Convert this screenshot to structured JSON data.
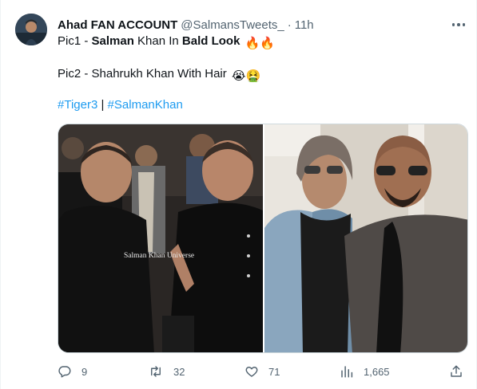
{
  "tweet": {
    "author_name": "Ahad FAN ACCOUNT",
    "handle": "@SalmansTweets_",
    "separator": "·",
    "time": "11h",
    "line1": {
      "prefix": "Pic1 - ",
      "bold1": "Salman",
      "mid": " Khan In ",
      "bold2": "Bald Look",
      "emoji": "🔥🔥"
    },
    "line2": {
      "text": "Pic2 - Shahrukh Khan With Hair",
      "emoji": "😭🤮"
    },
    "hashtags": [
      "#Tiger3",
      "#SalmanKhan"
    ],
    "hashtag_separator": " | "
  },
  "media": {
    "pic1_watermark": "Salman Khan Universe",
    "pic1_icon": "photo-salman-bald",
    "pic2_icon": "photo-shahrukh-hair"
  },
  "actions": {
    "replies": "9",
    "retweets": "32",
    "likes": "71",
    "views": "1,665"
  },
  "colors": {
    "text": "#0f1419",
    "secondary": "#536471",
    "link": "#1d9bf0",
    "border": "#cfd9de"
  }
}
